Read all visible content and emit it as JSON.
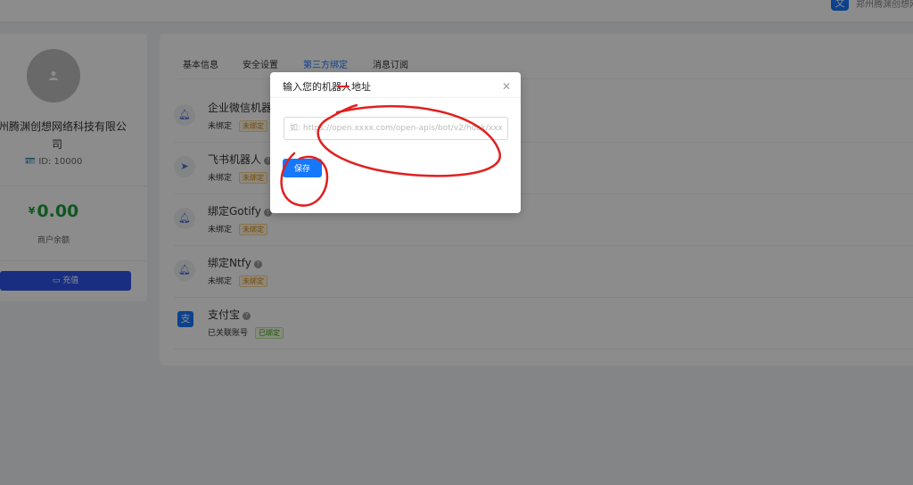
{
  "header": {
    "right_text": "郑州腾渊创想网络"
  },
  "profile": {
    "company_name": "郑州腾渊创想网络科技有限公司",
    "id_text": "ID: 10000",
    "currency_symbol": "¥",
    "balance": "0.00",
    "balance_label": "商户余额",
    "recharge_label": "充值"
  },
  "tabs": [
    {
      "label": "基本信息",
      "active": false
    },
    {
      "label": "安全设置",
      "active": false
    },
    {
      "label": "第三方绑定",
      "active": true
    },
    {
      "label": "消息订阅",
      "active": false
    }
  ],
  "bindings": [
    {
      "title": "企业微信机器人",
      "icon": "bell-icon",
      "status": "未绑定",
      "tag": "未绑定"
    },
    {
      "title": "飞书机器人",
      "icon": "send-icon",
      "status": "未绑定",
      "tag": "未绑定"
    },
    {
      "title": "绑定Gotify",
      "icon": "bell-icon",
      "status": "未绑定",
      "tag": "未绑定"
    },
    {
      "title": "绑定Ntfy",
      "icon": "bell-icon",
      "status": "未绑定",
      "tag": "未绑定"
    },
    {
      "title": "支付宝",
      "icon": "alipay-icon",
      "status": "已关联账号",
      "tag": "已绑定"
    }
  ],
  "modal": {
    "title": "输入您的机器人地址",
    "input_value": "",
    "input_placeholder": "如: https://open.xxxx.com/open-apis/bot/v2/hook/xxxx",
    "save_label": "保存"
  },
  "colors": {
    "primary": "#1677ff",
    "recharge_button": "#2f54eb",
    "balance": "#1e9e3e",
    "annotation": "#e02020"
  }
}
